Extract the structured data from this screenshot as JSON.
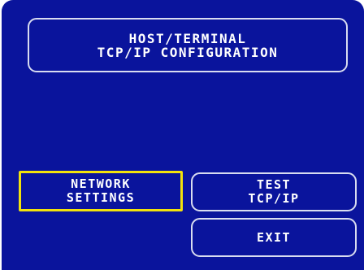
{
  "title": {
    "line1": "HOST/TERMINAL",
    "line2": "TCP/IP CONFIGURATION"
  },
  "buttons": {
    "network_settings": {
      "line1": "NETWORK",
      "line2": "SETTINGS",
      "selected": true
    },
    "test_tcpip": {
      "line1": "TEST",
      "line2": "TCP/IP"
    },
    "exit": {
      "label": "EXIT"
    }
  },
  "colors": {
    "background": "#0a149c",
    "text": "#ffffff",
    "border": "#d8dcf0",
    "highlight": "#f2e20c"
  }
}
